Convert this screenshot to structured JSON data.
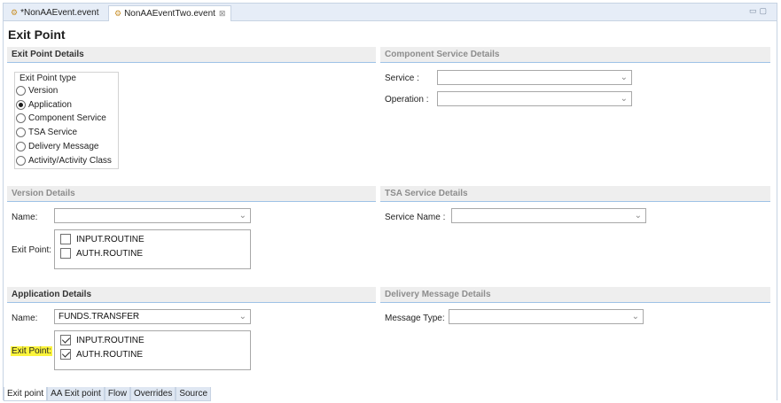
{
  "tabs": [
    {
      "label": "*NonAAEvent.event",
      "icon": "event-file-icon",
      "active": false
    },
    {
      "label": "NonAAEventTwo.event",
      "icon": "event-file-icon",
      "active": true,
      "close": "⊠"
    }
  ],
  "window_controls": {
    "minimize": "▭",
    "maximize": "▢"
  },
  "page": {
    "title": "Exit Point"
  },
  "exit_point_details": {
    "header": "Exit Point Details",
    "group_label": "Exit Point type",
    "options": [
      {
        "label": "Version",
        "checked": false
      },
      {
        "label": "Application",
        "checked": true
      },
      {
        "label": "Component Service",
        "checked": false
      },
      {
        "label": "TSA Service",
        "checked": false
      },
      {
        "label": "Delivery Message",
        "checked": false
      },
      {
        "label": "Activity/Activity Class",
        "checked": false
      }
    ]
  },
  "component_service_details": {
    "header": "Component Service Details",
    "service_label": "Service :",
    "service_value": "",
    "operation_label": "Operation :",
    "operation_value": ""
  },
  "version_details": {
    "header": "Version Details",
    "name_label": "Name:",
    "name_value": "",
    "exit_point_label": "Exit Point:",
    "routines": [
      {
        "label": "INPUT.ROUTINE",
        "checked": false
      },
      {
        "label": "AUTH.ROUTINE",
        "checked": false
      }
    ]
  },
  "tsa_service_details": {
    "header": "TSA Service Details",
    "service_name_label": "Service Name :",
    "service_name_value": ""
  },
  "application_details": {
    "header": "Application Details",
    "name_label": "Name:",
    "name_value": "FUNDS.TRANSFER",
    "exit_point_label": "Exit Point:",
    "exit_point_highlight_color": "#fbf43b",
    "routines": [
      {
        "label": "INPUT.ROUTINE",
        "checked": true
      },
      {
        "label": "AUTH.ROUTINE",
        "checked": true
      }
    ]
  },
  "delivery_message_details": {
    "header": "Delivery Message Details",
    "message_type_label": "Message Type:",
    "message_type_value": ""
  },
  "dropdown_chevron": "⌄",
  "bottom_tabs": [
    {
      "label": "Exit point",
      "active": true
    },
    {
      "label": "AA Exit point",
      "active": false
    },
    {
      "label": "Flow",
      "active": false
    },
    {
      "label": "Overrides",
      "active": false
    },
    {
      "label": "Source",
      "active": false
    }
  ],
  "colors": {
    "tab_bar": "#e6edf7",
    "section_header_bg": "#eeeeee",
    "section_underline": "#9ec2e6",
    "muted_header_text": "#8d8d8d"
  }
}
